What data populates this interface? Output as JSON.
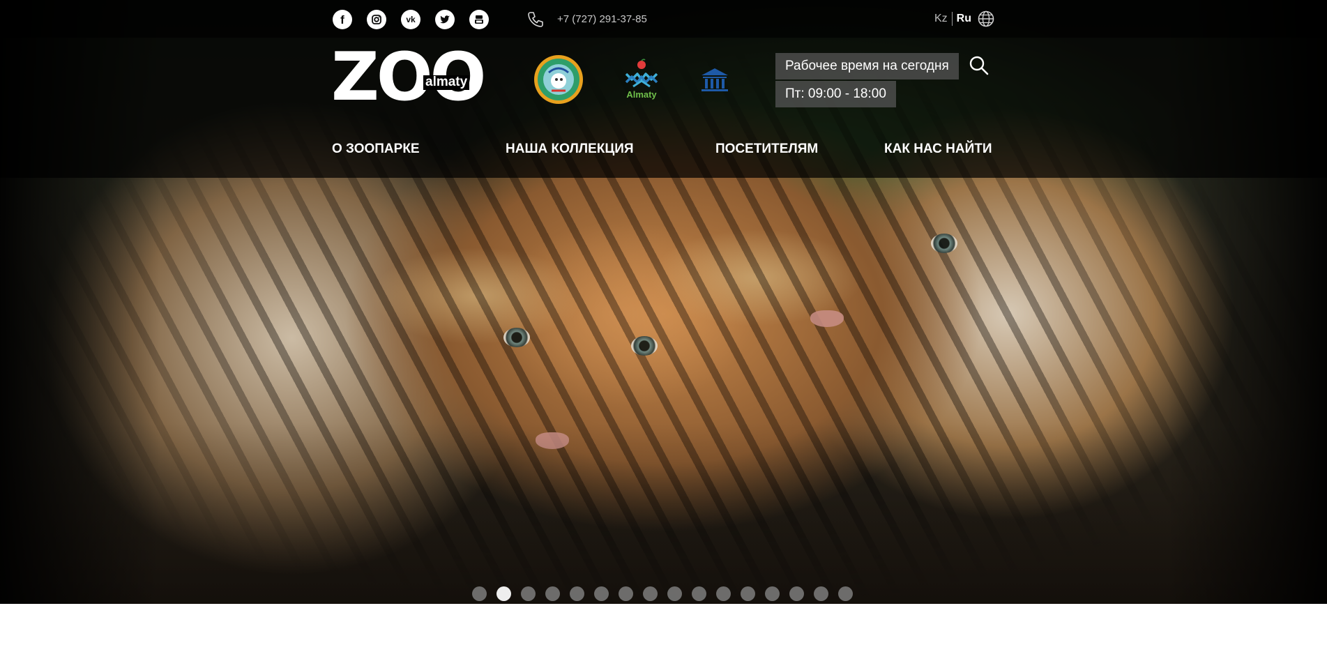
{
  "header": {
    "social": [
      {
        "name": "facebook",
        "icon": "facebook-icon",
        "glyph": "f"
      },
      {
        "name": "instagram",
        "icon": "instagram-icon",
        "glyph": ""
      },
      {
        "name": "vk",
        "icon": "vk-icon",
        "glyph": "vk"
      },
      {
        "name": "twitter",
        "icon": "twitter-icon",
        "glyph": ""
      },
      {
        "name": "youtube",
        "icon": "youtube-icon",
        "glyph": ""
      }
    ],
    "phone": "+7 (727) 291-37-85",
    "lang_kz": "Kz",
    "lang_ru": "Ru",
    "logo_main": "ZOO",
    "logo_sub": "almaty",
    "partner_logo_text": "Almaty",
    "hours_label": "Рабочее время на сегодня",
    "hours_value": "Пт: 09:00 - 18:00"
  },
  "nav": [
    {
      "label": "О ЗООПАРКЕ"
    },
    {
      "label": "НАША КОЛЛЕКЦИЯ"
    },
    {
      "label": "ПОСЕТИТЕЛЯМ"
    },
    {
      "label": "КАК НАС НАЙТИ"
    }
  ],
  "slider": {
    "slide_count": 16,
    "active_slide": 2
  },
  "colors": {
    "topbar": "#000000",
    "text": "#ffffff",
    "hours_bg": "#555555",
    "dot": "#7d7d7d",
    "dot_active": "#eeeeee"
  }
}
